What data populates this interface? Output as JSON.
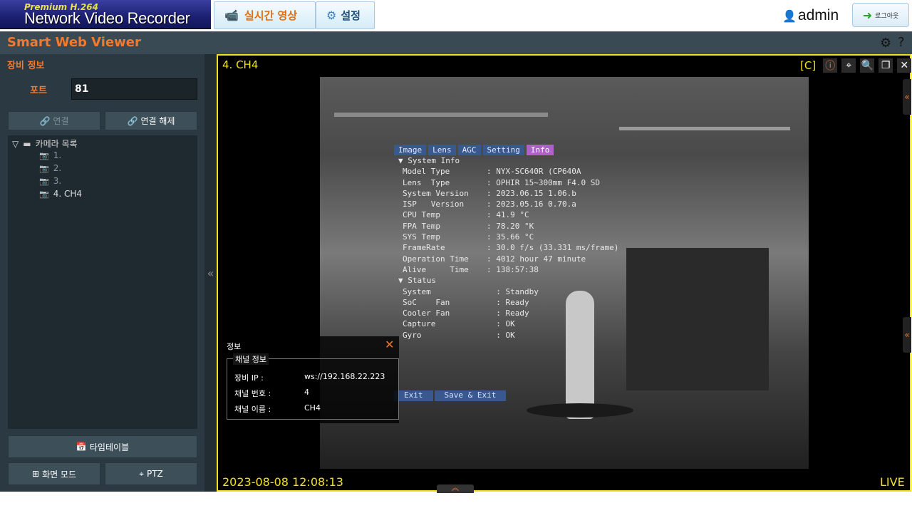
{
  "header": {
    "logo_sub": "Premium H.264",
    "logo_main": "Network Video Recorder",
    "tabs": [
      {
        "label": "실시간 영상",
        "active": true
      },
      {
        "label": "설정",
        "active": false
      }
    ],
    "user": "admin",
    "logout_label": "로그아웃"
  },
  "titlebar": {
    "title": "Smart Web Viewer"
  },
  "sidebar": {
    "section_title": "장비 정보",
    "port_label": "포트",
    "port_value": "81",
    "connect_label": "연결",
    "disconnect_label": "연결 해제",
    "tree": {
      "root": "카메라 목록",
      "items": [
        "1.",
        "2.",
        "3.",
        "4. CH4"
      ]
    },
    "timetable_label": "타임테이블",
    "screenmode_label": "화면 모드",
    "ptz_label": "PTZ"
  },
  "viewer": {
    "channel_label": "4. CH4",
    "code_label": "[C]",
    "timestamp": "2023-08-08 12:08:13",
    "live_label": "LIVE",
    "osd": {
      "tabs": [
        "Image",
        "Lens",
        "AGC",
        "Setting",
        "Info"
      ],
      "active_tab": "Info",
      "section1": "▼ System Info",
      "rows1": [
        {
          "k": "Model Type",
          "v": ": NYX-SC640R (CP640A"
        },
        {
          "k": "Lens  Type",
          "v": ": OPHIR 15~300mm F4.0 SD"
        },
        {
          "k": "System Version",
          "v": ": 2023.06.15 1.06.b"
        },
        {
          "k": "ISP   Version",
          "v": ": 2023.05.16 0.70.a"
        },
        {
          "k": "CPU Temp",
          "v": ": 41.9 °C"
        },
        {
          "k": "FPA Temp",
          "v": ": 78.20 °K"
        },
        {
          "k": "SYS Temp",
          "v": ": 35.66 °C"
        },
        {
          "k": "FrameRate",
          "v": ": 30.0 f/s (33.331 ms/frame)"
        },
        {
          "k": "Operation Time",
          "v": ": 4012 hour 47 minute"
        },
        {
          "k": "Alive     Time",
          "v": ": 138:57:38"
        }
      ],
      "section2": "▼ Status",
      "rows2": [
        {
          "k": "System",
          "v": "  : Standby"
        },
        {
          "k": "SoC    Fan",
          "v": "  : Ready"
        },
        {
          "k": "Cooler Fan",
          "v": "  : Ready"
        },
        {
          "k": "Capture",
          "v": "  : OK"
        },
        {
          "k": "Gyro",
          "v": "  : OK"
        }
      ],
      "buttons": [
        "Exit",
        "Save & Exit"
      ]
    },
    "info_panel": {
      "title": "정보",
      "legend": "채널 정보",
      "rows": [
        {
          "k": "장비 IP :",
          "v": "ws://192.168.22.223"
        },
        {
          "k": "채널 번호 :",
          "v": "4"
        },
        {
          "k": "채널 이름 :",
          "v": "CH4"
        }
      ]
    }
  },
  "colors": {
    "accent": "#f07a30",
    "highlight": "#f0e020",
    "panel": "#2b3a42"
  }
}
